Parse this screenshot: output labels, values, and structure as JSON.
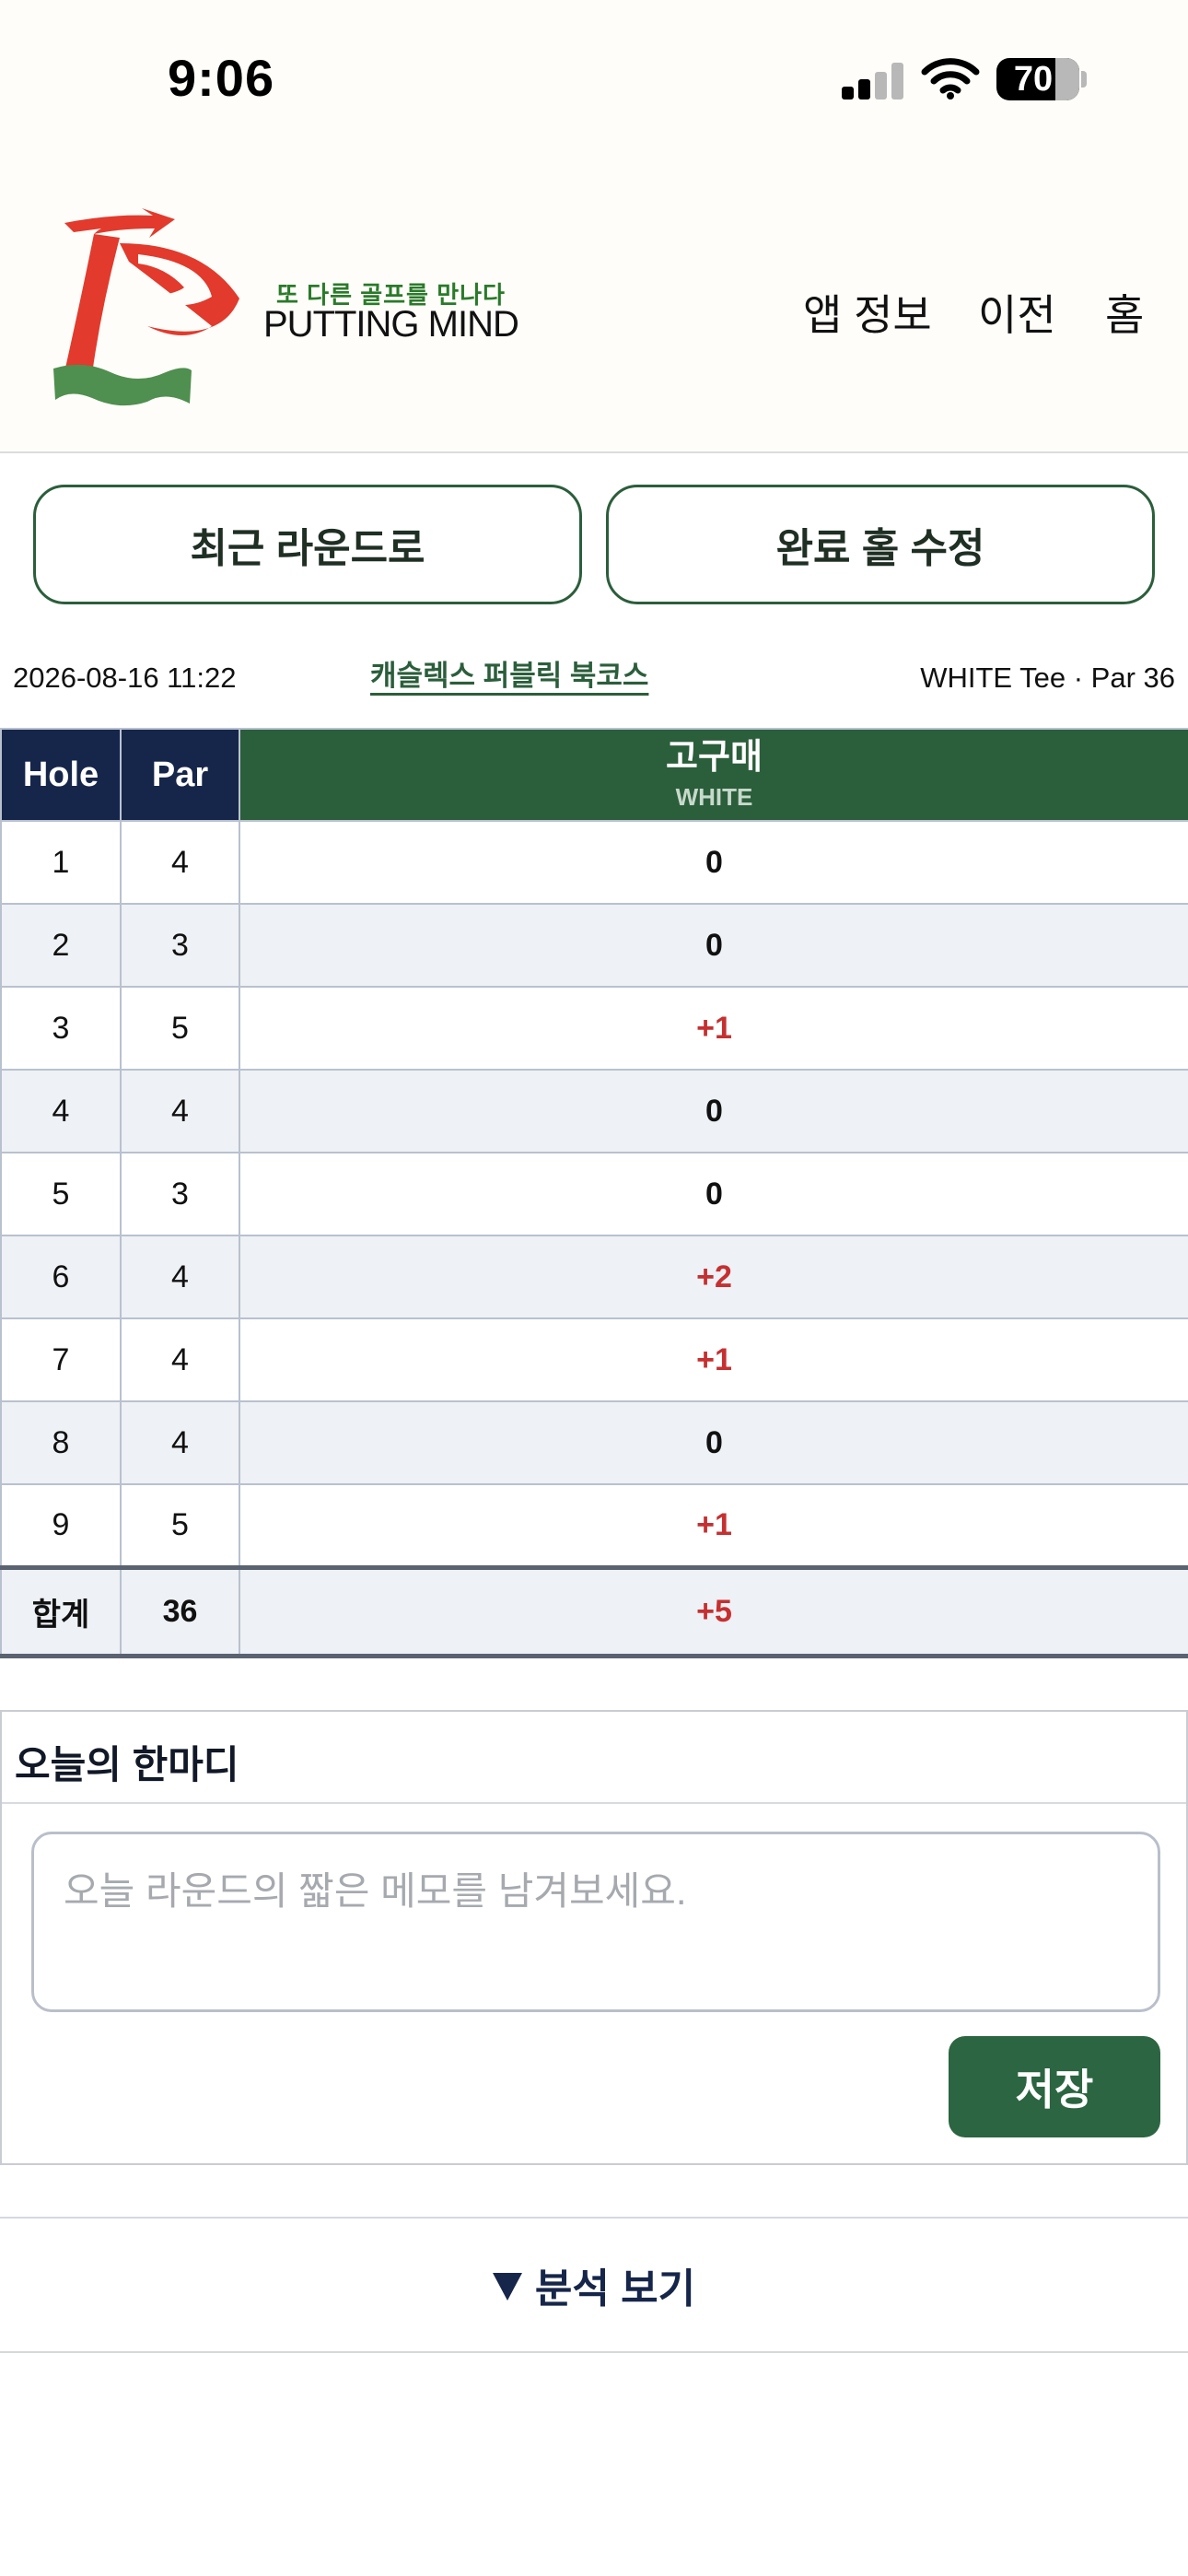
{
  "status_bar": {
    "time": "9:06",
    "battery": "70",
    "icons": [
      "cellular-signal-icon",
      "wifi-icon",
      "battery-icon"
    ]
  },
  "header": {
    "tagline": "또 다른 골프를 만나다",
    "brand": "PUTTING MIND",
    "nav": [
      "앱 정보",
      "이전",
      "홈"
    ]
  },
  "actions": {
    "recent_round": "최근 라운드로",
    "edit_holes": "완료 홀 수정"
  },
  "round": {
    "datetime": "2026-08-16 11:22",
    "course": "캐슬렉스 퍼블릭 북코스",
    "tee_par": "WHITE Tee · Par 36"
  },
  "table": {
    "headers": {
      "hole": "Hole",
      "par": "Par"
    },
    "player": {
      "name": "고구매",
      "tee": "WHITE"
    },
    "rows": [
      {
        "hole": "1",
        "par": "4",
        "score": "0"
      },
      {
        "hole": "2",
        "par": "3",
        "score": "0"
      },
      {
        "hole": "3",
        "par": "5",
        "score": "+1"
      },
      {
        "hole": "4",
        "par": "4",
        "score": "0"
      },
      {
        "hole": "5",
        "par": "3",
        "score": "0"
      },
      {
        "hole": "6",
        "par": "4",
        "score": "+2"
      },
      {
        "hole": "7",
        "par": "4",
        "score": "+1"
      },
      {
        "hole": "8",
        "par": "4",
        "score": "0"
      },
      {
        "hole": "9",
        "par": "5",
        "score": "+1"
      }
    ],
    "total": {
      "label": "합계",
      "par": "36",
      "score": "+5"
    }
  },
  "memo": {
    "title": "오늘의 한마디",
    "placeholder": "오늘 라운드의 짧은 메모를 남겨보세요.",
    "value": "",
    "save_label": "저장"
  },
  "analysis": {
    "label": "분석 보기"
  },
  "colors": {
    "primary_green": "#2b5e3b",
    "navy": "#16264a",
    "over_par_red": "#c53030",
    "logo_red": "#e23a2c",
    "logo_green": "#4f8f4f"
  }
}
